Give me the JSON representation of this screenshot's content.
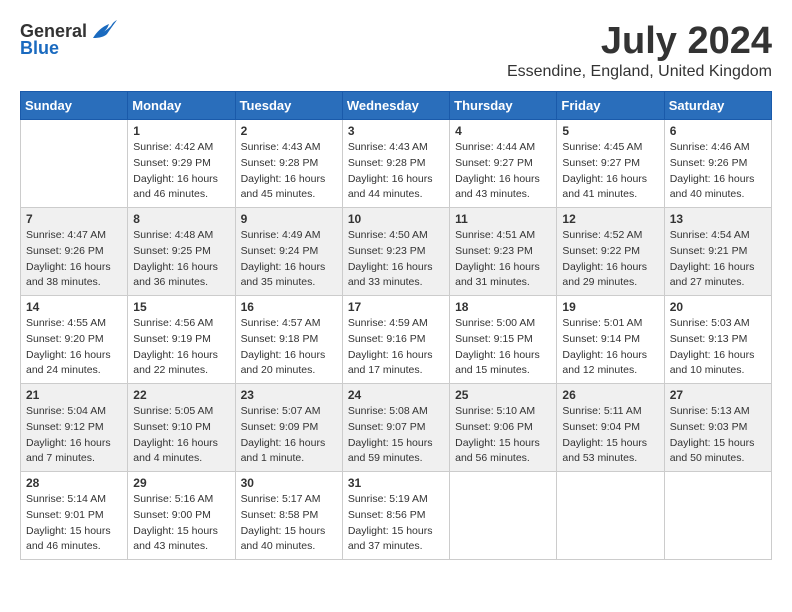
{
  "logo": {
    "general": "General",
    "blue": "Blue"
  },
  "title": "July 2024",
  "subtitle": "Essendine, England, United Kingdom",
  "days_of_week": [
    "Sunday",
    "Monday",
    "Tuesday",
    "Wednesday",
    "Thursday",
    "Friday",
    "Saturday"
  ],
  "weeks": [
    [
      {
        "day": "",
        "info": ""
      },
      {
        "day": "1",
        "info": "Sunrise: 4:42 AM\nSunset: 9:29 PM\nDaylight: 16 hours\nand 46 minutes."
      },
      {
        "day": "2",
        "info": "Sunrise: 4:43 AM\nSunset: 9:28 PM\nDaylight: 16 hours\nand 45 minutes."
      },
      {
        "day": "3",
        "info": "Sunrise: 4:43 AM\nSunset: 9:28 PM\nDaylight: 16 hours\nand 44 minutes."
      },
      {
        "day": "4",
        "info": "Sunrise: 4:44 AM\nSunset: 9:27 PM\nDaylight: 16 hours\nand 43 minutes."
      },
      {
        "day": "5",
        "info": "Sunrise: 4:45 AM\nSunset: 9:27 PM\nDaylight: 16 hours\nand 41 minutes."
      },
      {
        "day": "6",
        "info": "Sunrise: 4:46 AM\nSunset: 9:26 PM\nDaylight: 16 hours\nand 40 minutes."
      }
    ],
    [
      {
        "day": "7",
        "info": "Sunrise: 4:47 AM\nSunset: 9:26 PM\nDaylight: 16 hours\nand 38 minutes."
      },
      {
        "day": "8",
        "info": "Sunrise: 4:48 AM\nSunset: 9:25 PM\nDaylight: 16 hours\nand 36 minutes."
      },
      {
        "day": "9",
        "info": "Sunrise: 4:49 AM\nSunset: 9:24 PM\nDaylight: 16 hours\nand 35 minutes."
      },
      {
        "day": "10",
        "info": "Sunrise: 4:50 AM\nSunset: 9:23 PM\nDaylight: 16 hours\nand 33 minutes."
      },
      {
        "day": "11",
        "info": "Sunrise: 4:51 AM\nSunset: 9:23 PM\nDaylight: 16 hours\nand 31 minutes."
      },
      {
        "day": "12",
        "info": "Sunrise: 4:52 AM\nSunset: 9:22 PM\nDaylight: 16 hours\nand 29 minutes."
      },
      {
        "day": "13",
        "info": "Sunrise: 4:54 AM\nSunset: 9:21 PM\nDaylight: 16 hours\nand 27 minutes."
      }
    ],
    [
      {
        "day": "14",
        "info": "Sunrise: 4:55 AM\nSunset: 9:20 PM\nDaylight: 16 hours\nand 24 minutes."
      },
      {
        "day": "15",
        "info": "Sunrise: 4:56 AM\nSunset: 9:19 PM\nDaylight: 16 hours\nand 22 minutes."
      },
      {
        "day": "16",
        "info": "Sunrise: 4:57 AM\nSunset: 9:18 PM\nDaylight: 16 hours\nand 20 minutes."
      },
      {
        "day": "17",
        "info": "Sunrise: 4:59 AM\nSunset: 9:16 PM\nDaylight: 16 hours\nand 17 minutes."
      },
      {
        "day": "18",
        "info": "Sunrise: 5:00 AM\nSunset: 9:15 PM\nDaylight: 16 hours\nand 15 minutes."
      },
      {
        "day": "19",
        "info": "Sunrise: 5:01 AM\nSunset: 9:14 PM\nDaylight: 16 hours\nand 12 minutes."
      },
      {
        "day": "20",
        "info": "Sunrise: 5:03 AM\nSunset: 9:13 PM\nDaylight: 16 hours\nand 10 minutes."
      }
    ],
    [
      {
        "day": "21",
        "info": "Sunrise: 5:04 AM\nSunset: 9:12 PM\nDaylight: 16 hours\nand 7 minutes."
      },
      {
        "day": "22",
        "info": "Sunrise: 5:05 AM\nSunset: 9:10 PM\nDaylight: 16 hours\nand 4 minutes."
      },
      {
        "day": "23",
        "info": "Sunrise: 5:07 AM\nSunset: 9:09 PM\nDaylight: 16 hours\nand 1 minute."
      },
      {
        "day": "24",
        "info": "Sunrise: 5:08 AM\nSunset: 9:07 PM\nDaylight: 15 hours\nand 59 minutes."
      },
      {
        "day": "25",
        "info": "Sunrise: 5:10 AM\nSunset: 9:06 PM\nDaylight: 15 hours\nand 56 minutes."
      },
      {
        "day": "26",
        "info": "Sunrise: 5:11 AM\nSunset: 9:04 PM\nDaylight: 15 hours\nand 53 minutes."
      },
      {
        "day": "27",
        "info": "Sunrise: 5:13 AM\nSunset: 9:03 PM\nDaylight: 15 hours\nand 50 minutes."
      }
    ],
    [
      {
        "day": "28",
        "info": "Sunrise: 5:14 AM\nSunset: 9:01 PM\nDaylight: 15 hours\nand 46 minutes."
      },
      {
        "day": "29",
        "info": "Sunrise: 5:16 AM\nSunset: 9:00 PM\nDaylight: 15 hours\nand 43 minutes."
      },
      {
        "day": "30",
        "info": "Sunrise: 5:17 AM\nSunset: 8:58 PM\nDaylight: 15 hours\nand 40 minutes."
      },
      {
        "day": "31",
        "info": "Sunrise: 5:19 AM\nSunset: 8:56 PM\nDaylight: 15 hours\nand 37 minutes."
      },
      {
        "day": "",
        "info": ""
      },
      {
        "day": "",
        "info": ""
      },
      {
        "day": "",
        "info": ""
      }
    ]
  ]
}
